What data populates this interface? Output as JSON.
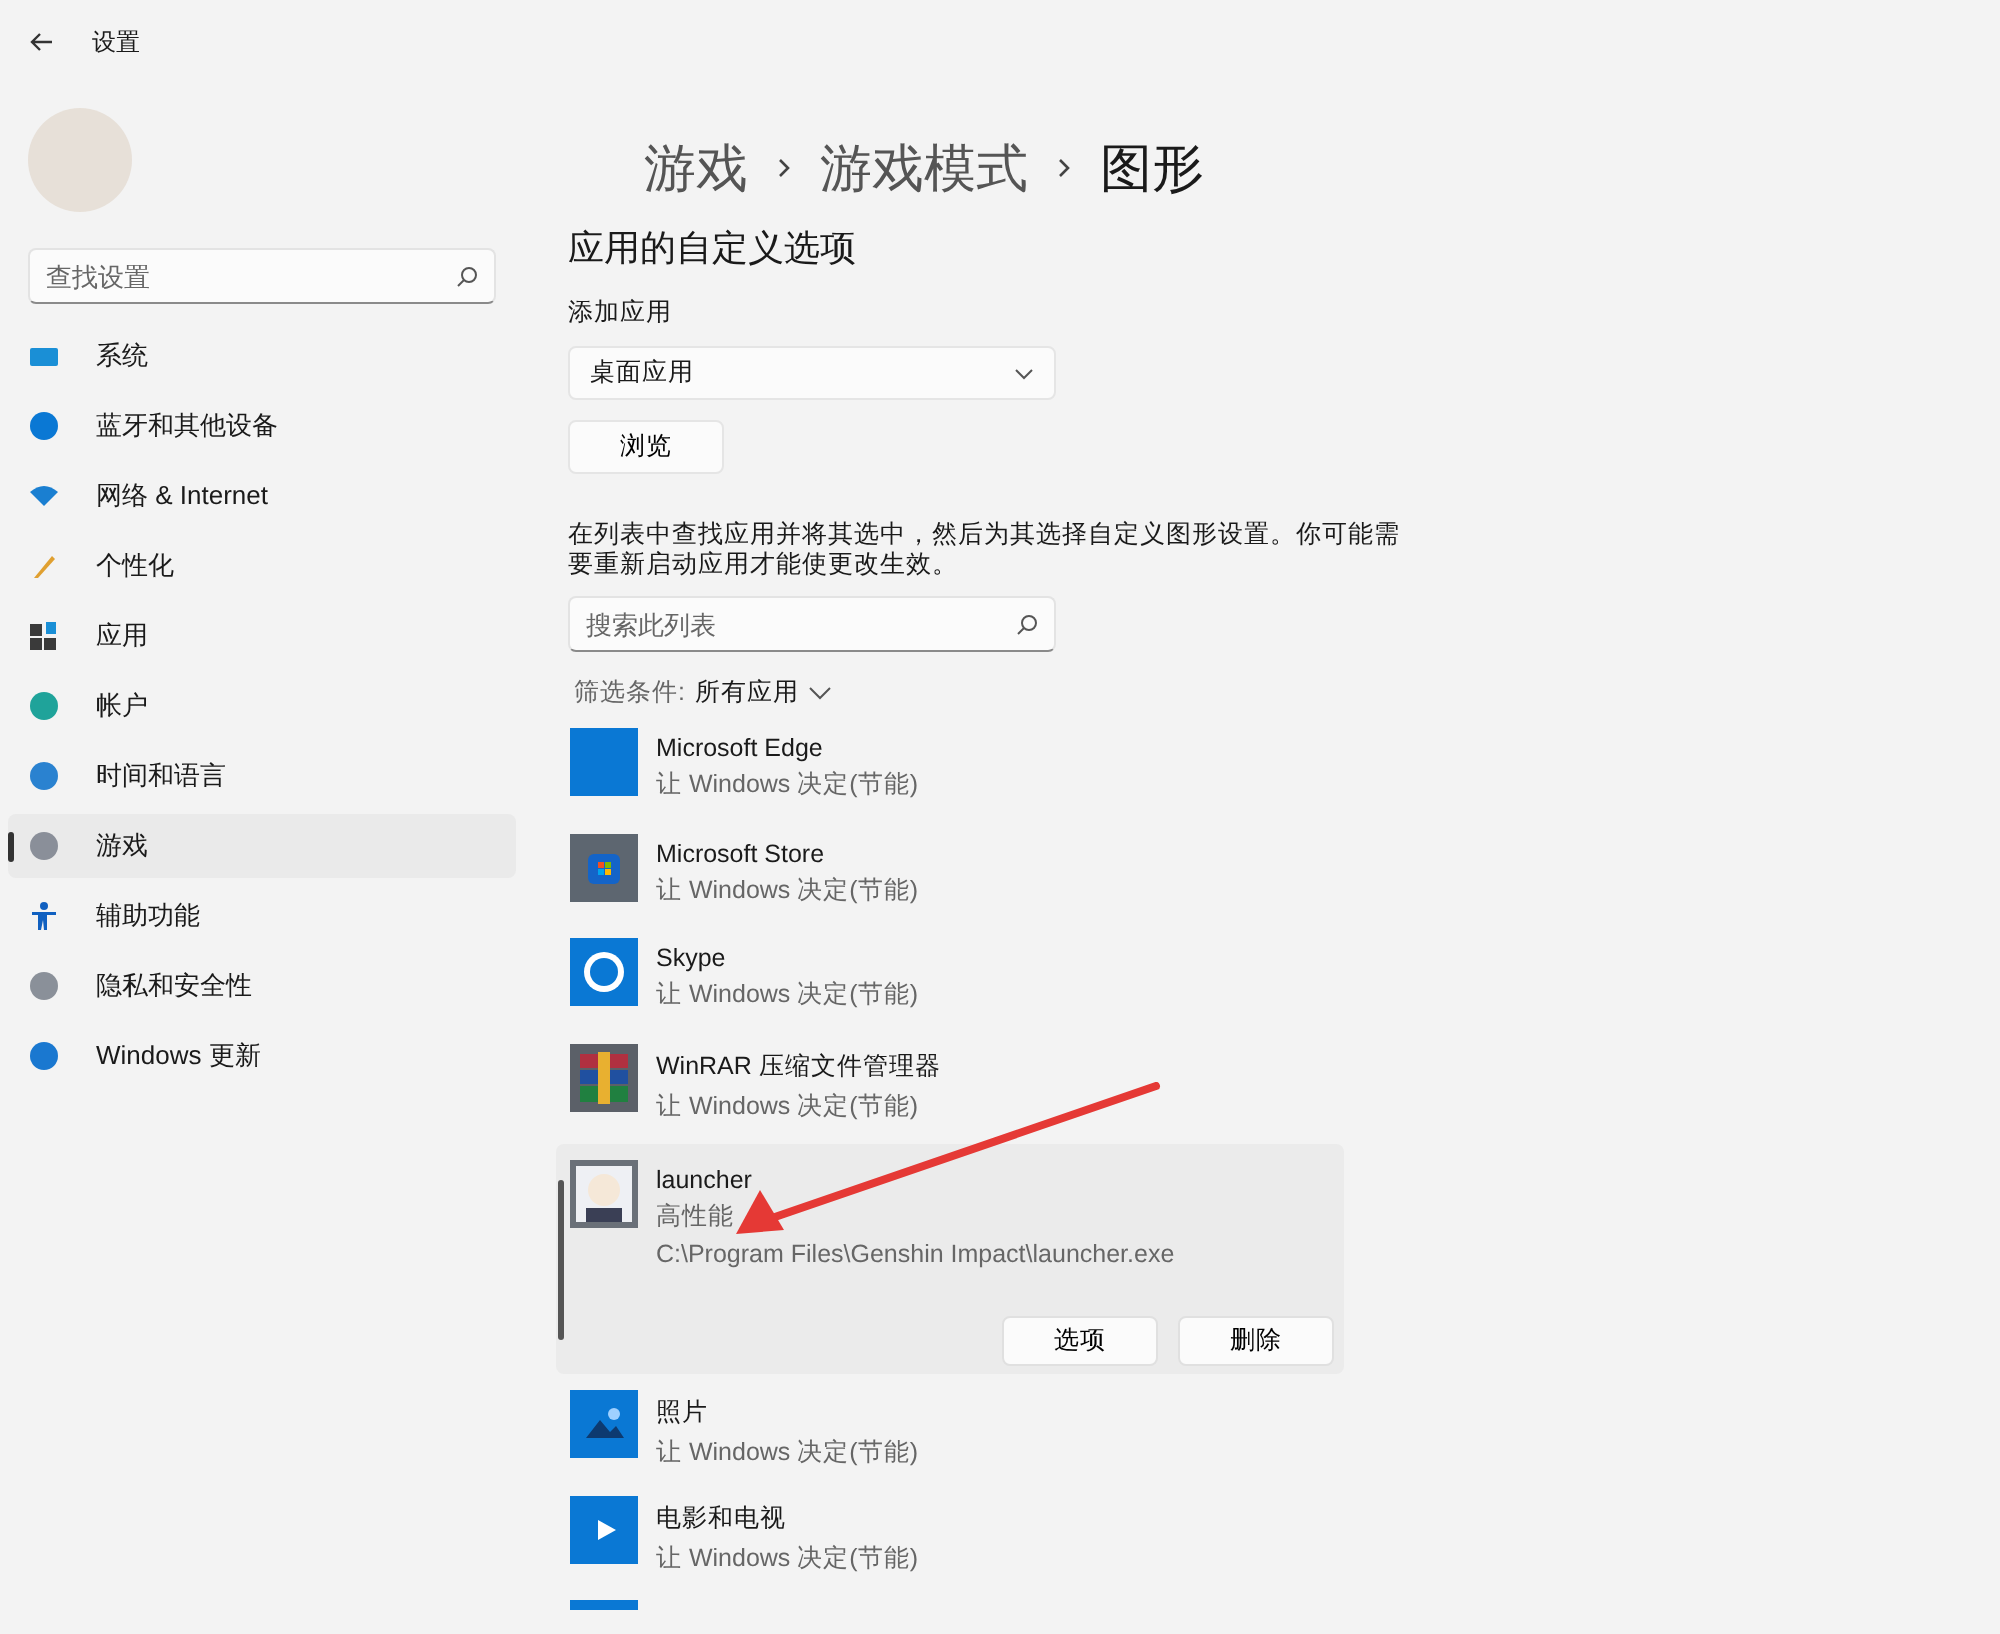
{
  "window": {
    "title": "设置"
  },
  "sidebar": {
    "search": {
      "placeholder": "查找设置"
    },
    "items": [
      {
        "label": "系统",
        "selected": false
      },
      {
        "label": "蓝牙和其他设备",
        "selected": false
      },
      {
        "label": "网络 & Internet",
        "selected": false
      },
      {
        "label": "个性化",
        "selected": false
      },
      {
        "label": "应用",
        "selected": false
      },
      {
        "label": "帐户",
        "selected": false
      },
      {
        "label": "时间和语言",
        "selected": false
      },
      {
        "label": "游戏",
        "selected": true
      },
      {
        "label": "辅助功能",
        "selected": false
      },
      {
        "label": "隐私和安全性",
        "selected": false
      },
      {
        "label": "Windows 更新",
        "selected": false
      }
    ]
  },
  "breadcrumb": [
    "游戏",
    "游戏模式",
    "图形"
  ],
  "section_title": "应用的自定义选项",
  "add_app": {
    "label": "添加应用",
    "dropdown_value": "桌面应用",
    "browse_button": "浏览"
  },
  "description": "在列表中查找应用并将其选中，然后为其选择自定义图形设置。你可能需要重新启动应用才能使更改生效。",
  "list_search": {
    "placeholder": "搜索此列表"
  },
  "filter": {
    "label": "筛选条件:",
    "value": "所有应用"
  },
  "apps": [
    {
      "name": "Microsoft Edge",
      "setting": "让 Windows 决定(节能)",
      "expanded": false
    },
    {
      "name": "Microsoft Store",
      "setting": "让 Windows 决定(节能)",
      "expanded": false
    },
    {
      "name": "Skype",
      "setting": "让 Windows 决定(节能)",
      "expanded": false
    },
    {
      "name": "WinRAR 压缩文件管理器",
      "setting": "让 Windows 决定(节能)",
      "expanded": false
    },
    {
      "name": "launcher",
      "setting": "高性能",
      "expanded": true,
      "path": "C:\\Program Files\\Genshin Impact\\launcher.exe",
      "buttons": [
        "选项",
        "删除"
      ]
    },
    {
      "name": "照片",
      "setting": "让 Windows 决定(节能)",
      "expanded": false
    },
    {
      "name": "电影和电视",
      "setting": "让 Windows 决定(节能)",
      "expanded": false
    }
  ]
}
